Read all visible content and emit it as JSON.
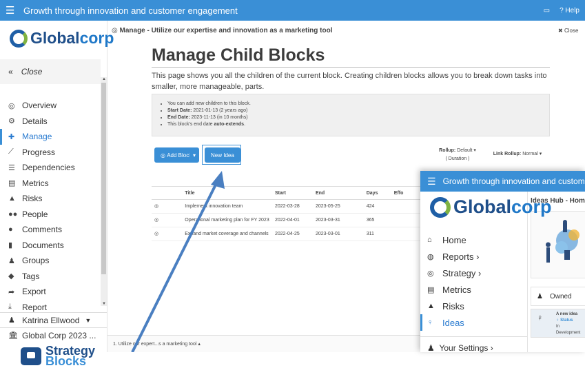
{
  "topbar": {
    "title": "Growth through innovation and customer engagement",
    "help_label": "Help",
    "menu_icon": "hamburger-icon",
    "screen_icon": "monitor-icon"
  },
  "sidebar": {
    "logo": {
      "main": "Global",
      "accent": "corp"
    },
    "close_label": "Close",
    "items": [
      {
        "label": "Overview",
        "icon": "target-icon"
      },
      {
        "label": "Details",
        "icon": "gear-icon"
      },
      {
        "label": "Manage",
        "icon": "plus-icon",
        "active": true
      },
      {
        "label": "Progress",
        "icon": "chart-line-icon"
      },
      {
        "label": "Dependencies",
        "icon": "list-icon"
      },
      {
        "label": "Metrics",
        "icon": "table-icon"
      },
      {
        "label": "Risks",
        "icon": "warning-icon"
      },
      {
        "label": "People",
        "icon": "people-icon"
      },
      {
        "label": "Comments",
        "icon": "comments-icon"
      },
      {
        "label": "Documents",
        "icon": "document-icon"
      },
      {
        "label": "Groups",
        "icon": "groups-icon"
      },
      {
        "label": "Tags",
        "icon": "tags-icon"
      },
      {
        "label": "Export",
        "icon": "export-icon"
      },
      {
        "label": "Report",
        "icon": "download-icon"
      }
    ],
    "user": "Katrina Ellwood",
    "org": "Global Corp 2023 ...",
    "footer_logo": {
      "line1": "Strategy",
      "line2": "Blocks"
    }
  },
  "main": {
    "breadcrumb": "Manage - Utilize our expertise and innovation as a marketing tool",
    "close_label": "Close",
    "title": "Manage Child Blocks",
    "description": "This page shows you all the children of the current block. Creating children blocks allows you to break down tasks into smaller, more manageable, parts.",
    "info": {
      "line1": "You can add new children to this block.",
      "start_label": "Start Date:",
      "start_value": "2021-01-13 (2 years ago)",
      "end_label": "End Date:",
      "end_value": "2023-11-13 (in 10 months)",
      "auto_prefix": "This block's end date",
      "auto_bold": "auto-extends",
      "auto_suffix": "."
    },
    "toolbar": {
      "add_block": "Add Block",
      "new_idea": "New Idea",
      "rollup_label": "Rollup:",
      "rollup_value": "Default",
      "rollup_sub": "( Duration )",
      "link_rollup_label": "Link Rollup:",
      "link_rollup_value": "Normal"
    },
    "table": {
      "headers": [
        "Title",
        "Start",
        "End",
        "Days",
        "Effo"
      ],
      "rows": [
        {
          "title": "Implement innovation team",
          "start": "2022-03-28",
          "end": "2023-05-25",
          "days": "424"
        },
        {
          "title": "Operational marketing plan for FY 2023",
          "start": "2022-04-01",
          "end": "2023-03-31",
          "days": "365"
        },
        {
          "title": "Expand market coverage and channels",
          "start": "2022-04-25",
          "end": "2023-03-01",
          "days": "311"
        }
      ]
    },
    "footer_tab": "1. Utilize our expert...s a marketing tool"
  },
  "mobile": {
    "title": "Growth through innovation and customer engagement",
    "logo": {
      "main": "Global",
      "accent": "corp"
    },
    "nav": [
      {
        "label": "Home",
        "icon": "home-icon"
      },
      {
        "label": "Reports",
        "icon": "reports-icon",
        "chevron": "›"
      },
      {
        "label": "Strategy",
        "icon": "target-icon",
        "chevron": "›"
      },
      {
        "label": "Metrics",
        "icon": "table-icon"
      },
      {
        "label": "Risks",
        "icon": "warning-icon"
      },
      {
        "label": "Ideas",
        "icon": "lightbulb-icon",
        "active": true
      }
    ],
    "settings": "Your Settings ›",
    "hub_title": "Ideas Hub - Home",
    "owned": "Owned",
    "idea_card": {
      "title": "A new idea",
      "status_label": "Status",
      "status_value": "In Development"
    }
  },
  "colors": {
    "brand": "#3a8fd6",
    "logo_dark": "#1f4f8a",
    "accent_green": "#7fb241",
    "arrow": "#4a7fc1"
  }
}
